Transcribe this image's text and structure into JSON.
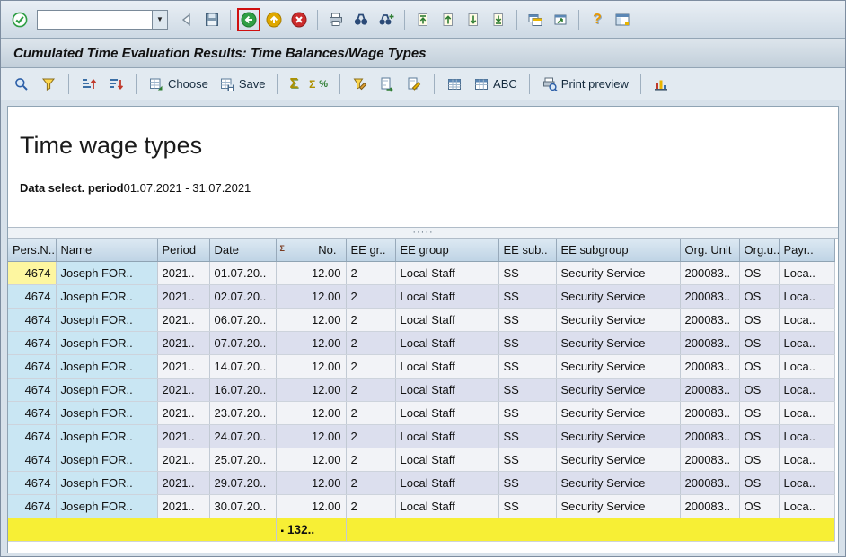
{
  "top_toolbar": {
    "command_field": {
      "value": ""
    }
  },
  "title_bar": {
    "title": "Cumulated Time Evaluation Results: Time Balances/Wage Types"
  },
  "app_toolbar": {
    "choose_label": "Choose",
    "save_label": "Save",
    "abc_label": "ABC",
    "print_preview_label": "Print preview"
  },
  "report": {
    "title": "Time wage types",
    "period_label": "Data select. period",
    "period_value": "01.07.2021 - 31.07.2021"
  },
  "grid": {
    "columns": [
      {
        "key": "persno",
        "label": "Pers.N.."
      },
      {
        "key": "name",
        "label": "Name"
      },
      {
        "key": "period",
        "label": "Period"
      },
      {
        "key": "date",
        "label": "Date"
      },
      {
        "key": "no",
        "label": "No."
      },
      {
        "key": "eegr",
        "label": "EE gr.."
      },
      {
        "key": "eegroup",
        "label": "EE group"
      },
      {
        "key": "eesub",
        "label": "EE sub.."
      },
      {
        "key": "eesubgroup",
        "label": "EE subgroup"
      },
      {
        "key": "orgunit",
        "label": "Org. Unit"
      },
      {
        "key": "orgu",
        "label": "Org.u.."
      },
      {
        "key": "payr",
        "label": "Payr.."
      }
    ],
    "rows": [
      {
        "persno": "4674",
        "name": "Joseph FOR..",
        "period": "2021..",
        "date": "01.07.20..",
        "no": "12.00",
        "eegr": "2",
        "eegroup": "Local Staff",
        "eesub": "SS",
        "eesubgroup": "Security Service",
        "orgunit": "200083..",
        "orgu": "OS",
        "payr": "Loca.."
      },
      {
        "persno": "4674",
        "name": "Joseph FOR..",
        "period": "2021..",
        "date": "02.07.20..",
        "no": "12.00",
        "eegr": "2",
        "eegroup": "Local Staff",
        "eesub": "SS",
        "eesubgroup": "Security Service",
        "orgunit": "200083..",
        "orgu": "OS",
        "payr": "Loca.."
      },
      {
        "persno": "4674",
        "name": "Joseph FOR..",
        "period": "2021..",
        "date": "06.07.20..",
        "no": "12.00",
        "eegr": "2",
        "eegroup": "Local Staff",
        "eesub": "SS",
        "eesubgroup": "Security Service",
        "orgunit": "200083..",
        "orgu": "OS",
        "payr": "Loca.."
      },
      {
        "persno": "4674",
        "name": "Joseph FOR..",
        "period": "2021..",
        "date": "07.07.20..",
        "no": "12.00",
        "eegr": "2",
        "eegroup": "Local Staff",
        "eesub": "SS",
        "eesubgroup": "Security Service",
        "orgunit": "200083..",
        "orgu": "OS",
        "payr": "Loca.."
      },
      {
        "persno": "4674",
        "name": "Joseph FOR..",
        "period": "2021..",
        "date": "14.07.20..",
        "no": "12.00",
        "eegr": "2",
        "eegroup": "Local Staff",
        "eesub": "SS",
        "eesubgroup": "Security Service",
        "orgunit": "200083..",
        "orgu": "OS",
        "payr": "Loca.."
      },
      {
        "persno": "4674",
        "name": "Joseph FOR..",
        "period": "2021..",
        "date": "16.07.20..",
        "no": "12.00",
        "eegr": "2",
        "eegroup": "Local Staff",
        "eesub": "SS",
        "eesubgroup": "Security Service",
        "orgunit": "200083..",
        "orgu": "OS",
        "payr": "Loca.."
      },
      {
        "persno": "4674",
        "name": "Joseph FOR..",
        "period": "2021..",
        "date": "23.07.20..",
        "no": "12.00",
        "eegr": "2",
        "eegroup": "Local Staff",
        "eesub": "SS",
        "eesubgroup": "Security Service",
        "orgunit": "200083..",
        "orgu": "OS",
        "payr": "Loca.."
      },
      {
        "persno": "4674",
        "name": "Joseph FOR..",
        "period": "2021..",
        "date": "24.07.20..",
        "no": "12.00",
        "eegr": "2",
        "eegroup": "Local Staff",
        "eesub": "SS",
        "eesubgroup": "Security Service",
        "orgunit": "200083..",
        "orgu": "OS",
        "payr": "Loca.."
      },
      {
        "persno": "4674",
        "name": "Joseph FOR..",
        "period": "2021..",
        "date": "25.07.20..",
        "no": "12.00",
        "eegr": "2",
        "eegroup": "Local Staff",
        "eesub": "SS",
        "eesubgroup": "Security Service",
        "orgunit": "200083..",
        "orgu": "OS",
        "payr": "Loca.."
      },
      {
        "persno": "4674",
        "name": "Joseph FOR..",
        "period": "2021..",
        "date": "29.07.20..",
        "no": "12.00",
        "eegr": "2",
        "eegroup": "Local Staff",
        "eesub": "SS",
        "eesubgroup": "Security Service",
        "orgunit": "200083..",
        "orgu": "OS",
        "payr": "Loca.."
      },
      {
        "persno": "4674",
        "name": "Joseph FOR..",
        "period": "2021..",
        "date": "30.07.20..",
        "no": "12.00",
        "eegr": "2",
        "eegroup": "Local Staff",
        "eesub": "SS",
        "eesubgroup": "Security Service",
        "orgunit": "200083..",
        "orgu": "OS",
        "payr": "Loca.."
      }
    ],
    "total": "132.."
  },
  "icons": {
    "dropdown": "▼",
    "sigma": "Σ",
    "percent": "%",
    "question": "?",
    "bullet": "▪",
    "splitter_dots": "·····",
    "sum_small": "Σ"
  }
}
